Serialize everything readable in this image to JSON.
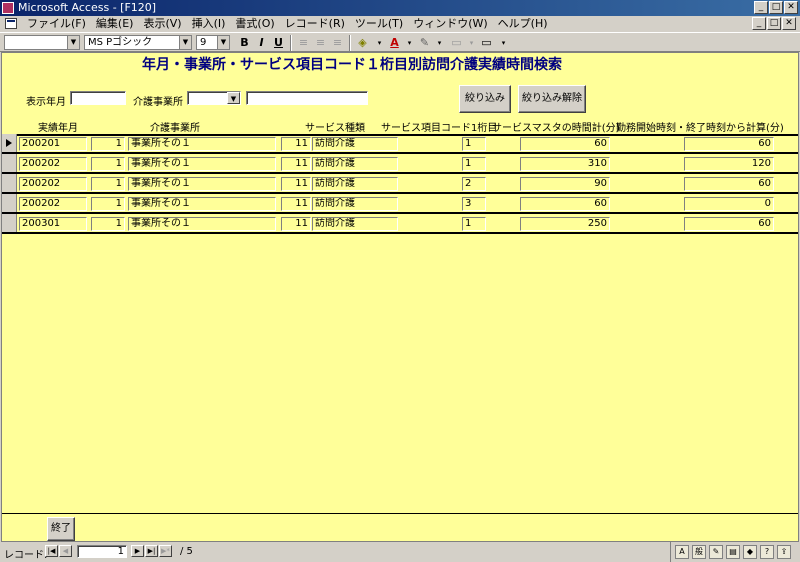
{
  "window": {
    "title": "Microsoft Access - [F120]",
    "min": "_",
    "max": "□",
    "close": "✕"
  },
  "menu": [
    "ファイル(F)",
    "編集(E)",
    "表示(V)",
    "挿入(I)",
    "書式(O)",
    "レコード(R)",
    "ツール(T)",
    "ウィンドウ(W)",
    "ヘルプ(H)"
  ],
  "toolbar": {
    "object_select": "",
    "font_name": "MS Pゴシック",
    "font_size": "9",
    "bold": "B",
    "italic": "I",
    "underline": "U"
  },
  "form": {
    "title": "年月・事業所・サービス項目コード１桁目別訪問介護実績時間検索",
    "filter": {
      "year_month_label": "表示年月",
      "year_month_value": "",
      "office_label": "介護事業所",
      "office_code_value": "",
      "office_name_value": "",
      "apply_button": "絞り込み",
      "clear_button": "絞り込み解除"
    },
    "columns": {
      "year_month": "実績年月",
      "office": "介護事業所",
      "service_type": "サービス種類",
      "service_code_digit": "サービス項目コード1桁目",
      "master_total": "サービスマスタの時間計(分)",
      "calc_total": "勤務開始時刻・終了時刻から計算(分)"
    },
    "rows": [
      {
        "ym": "200201",
        "office_no": "1",
        "office_name": "事業所その１",
        "svc_no": "11",
        "svc_name": "訪問介護",
        "digit": "1",
        "master": "60",
        "calc": "60"
      },
      {
        "ym": "200202",
        "office_no": "1",
        "office_name": "事業所その１",
        "svc_no": "11",
        "svc_name": "訪問介護",
        "digit": "1",
        "master": "310",
        "calc": "120"
      },
      {
        "ym": "200202",
        "office_no": "1",
        "office_name": "事業所その１",
        "svc_no": "11",
        "svc_name": "訪問介護",
        "digit": "2",
        "master": "90",
        "calc": "60"
      },
      {
        "ym": "200202",
        "office_no": "1",
        "office_name": "事業所その１",
        "svc_no": "11",
        "svc_name": "訪問介護",
        "digit": "3",
        "master": "60",
        "calc": "0"
      },
      {
        "ym": "200301",
        "office_no": "1",
        "office_name": "事業所その１",
        "svc_no": "11",
        "svc_name": "訪問介護",
        "digit": "1",
        "master": "250",
        "calc": "60"
      }
    ],
    "exit_button": "終了"
  },
  "status": {
    "record_label": "レコード:",
    "current": "1",
    "total": "/ 5",
    "ime_text": "般"
  }
}
